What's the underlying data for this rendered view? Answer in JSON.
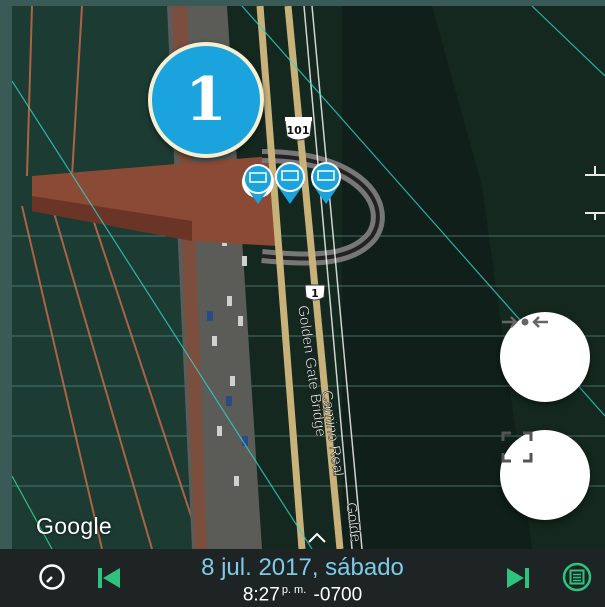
{
  "map": {
    "marker_number": "1",
    "attribution": "Google",
    "road_labels": {
      "golden_gate": "Golden Gate Bridge",
      "camino_real": "Camino Real",
      "golde": "Golde",
      "shield_101": "101",
      "shield_1": "1"
    }
  },
  "controls": {
    "collapse_icon": "arrows-collapse-icon",
    "fullscreen_icon": "fullscreen-icon"
  },
  "bottom_bar": {
    "date": "8 jul. 2017, sábado",
    "time": "8:27",
    "ampm": "p. m.",
    "tz": "-0700"
  },
  "colors": {
    "accent_green": "#2ec27e",
    "date_blue": "#7ccbe8",
    "badge_blue": "#1aa3dc"
  }
}
